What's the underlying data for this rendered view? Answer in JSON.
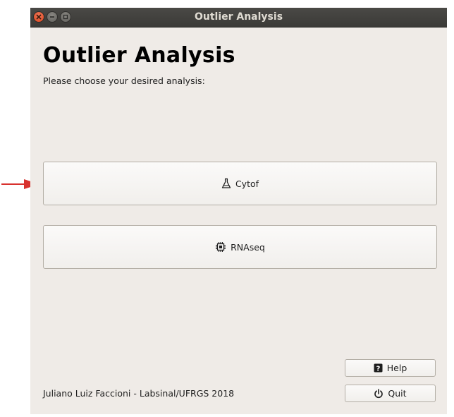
{
  "window": {
    "title": "Outlier Analysis",
    "controls": [
      "close-icon",
      "minimize-icon",
      "maximize-icon"
    ]
  },
  "main": {
    "heading": "Outlier Analysis",
    "subtitle": "Please choose your desired analysis:",
    "options": [
      {
        "label": "Cytof",
        "icon": "flask-icon"
      },
      {
        "label": "RNAseq",
        "icon": "chip-icon"
      }
    ]
  },
  "footer": {
    "credit": "Juliano Luiz Faccioni - Labsinal/UFRGS 2018",
    "help_label": "Help",
    "help_icon": "help-icon",
    "quit_label": "Quit",
    "quit_icon": "power-icon"
  },
  "colors": {
    "titlebar": "#3b3a37",
    "window_bg": "#efebe7",
    "close_button": "#e95420",
    "annotation_arrow": "#d8322e"
  }
}
